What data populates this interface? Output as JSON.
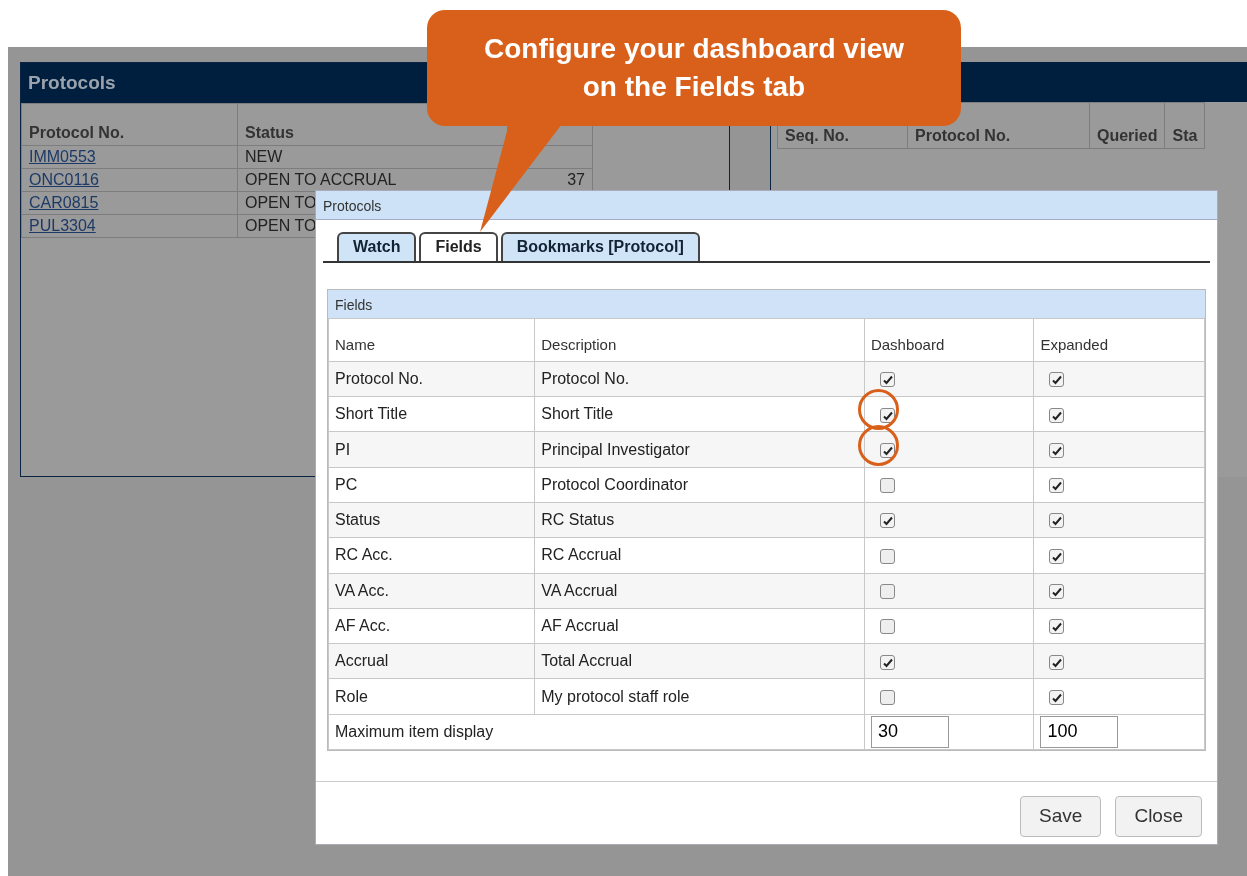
{
  "background": {
    "left_panel": {
      "title": "Protocols",
      "columns": [
        "Protocol No.",
        "Status"
      ],
      "rows": [
        {
          "protocol": "IMM0553",
          "status": "NEW",
          "column_3": ""
        },
        {
          "protocol": "ONC0116",
          "status": "OPEN TO ACCRUAL",
          "column_3": "37"
        },
        {
          "protocol": "CAR0815",
          "status": "OPEN TO",
          "column_3": ""
        },
        {
          "protocol": "PUL3304",
          "status": "OPEN TO",
          "column_3": ""
        }
      ]
    },
    "right_panel": {
      "columns": [
        "Seq. No.",
        "Protocol No.",
        "Queried",
        "Sta"
      ]
    }
  },
  "dialog": {
    "title": "Protocols",
    "tabs": [
      {
        "label": "Watch",
        "selected": false
      },
      {
        "label": "Fields",
        "selected": true
      },
      {
        "label": "Bookmarks [Protocol]",
        "selected": false
      }
    ],
    "section_title": "Fields",
    "columns": [
      "Name",
      "Description",
      "Dashboard",
      "Expanded"
    ],
    "rows": [
      {
        "name": "Protocol No.",
        "description": "Protocol No.",
        "dashboard": true,
        "expanded": true,
        "circled": false
      },
      {
        "name": "Short Title",
        "description": "Short Title",
        "dashboard": true,
        "expanded": true,
        "circled": true
      },
      {
        "name": "PI",
        "description": "Principal Investigator",
        "dashboard": true,
        "expanded": true,
        "circled": true
      },
      {
        "name": "PC",
        "description": "Protocol Coordinator",
        "dashboard": false,
        "expanded": true,
        "circled": false
      },
      {
        "name": "Status",
        "description": "RC Status",
        "dashboard": true,
        "expanded": true,
        "circled": false
      },
      {
        "name": "RC Acc.",
        "description": "RC Accrual",
        "dashboard": false,
        "expanded": true,
        "circled": false
      },
      {
        "name": "VA Acc.",
        "description": "VA Accrual",
        "dashboard": false,
        "expanded": true,
        "circled": false
      },
      {
        "name": "AF Acc.",
        "description": "AF Accrual",
        "dashboard": false,
        "expanded": true,
        "circled": false
      },
      {
        "name": "Accrual",
        "description": "Total Accrual",
        "dashboard": true,
        "expanded": true,
        "circled": false
      },
      {
        "name": "Role",
        "description": "My protocol staff role",
        "dashboard": false,
        "expanded": true,
        "circled": false
      }
    ],
    "max_display": {
      "label": "Maximum item display",
      "dashboard": "30",
      "expanded": "100"
    },
    "buttons": [
      "Save",
      "Close"
    ]
  },
  "callout": {
    "text": "Configure your dashboard view on the Fields tab"
  }
}
